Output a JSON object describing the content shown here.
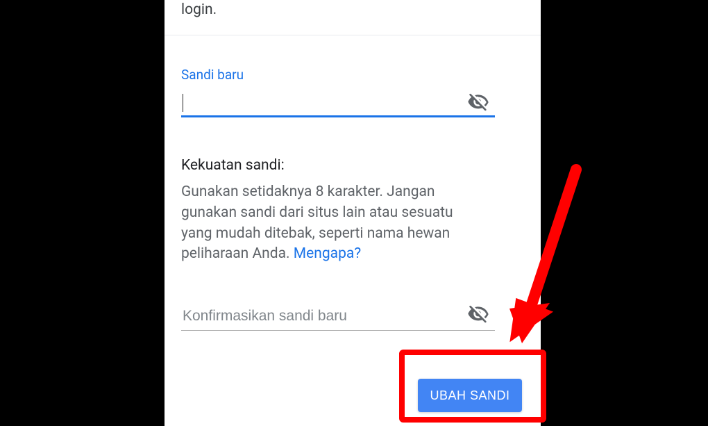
{
  "top_fragment": "login.",
  "new_password": {
    "label": "Sandi baru",
    "value": ""
  },
  "strength": {
    "label": "Kekuatan sandi:",
    "hint": "Gunakan setidaknya 8 karakter. Jangan gunakan sandi dari situs lain atau sesuatu yang mudah ditebak, seperti nama hewan peliharaan Anda. ",
    "why_link": "Mengapa?"
  },
  "confirm_password": {
    "placeholder": "Konfirmasikan sandi baru",
    "value": ""
  },
  "submit_label": "UBAH SANDI",
  "colors": {
    "primary": "#1a73e8",
    "button": "#4285f4",
    "annotation": "#ff0000"
  }
}
